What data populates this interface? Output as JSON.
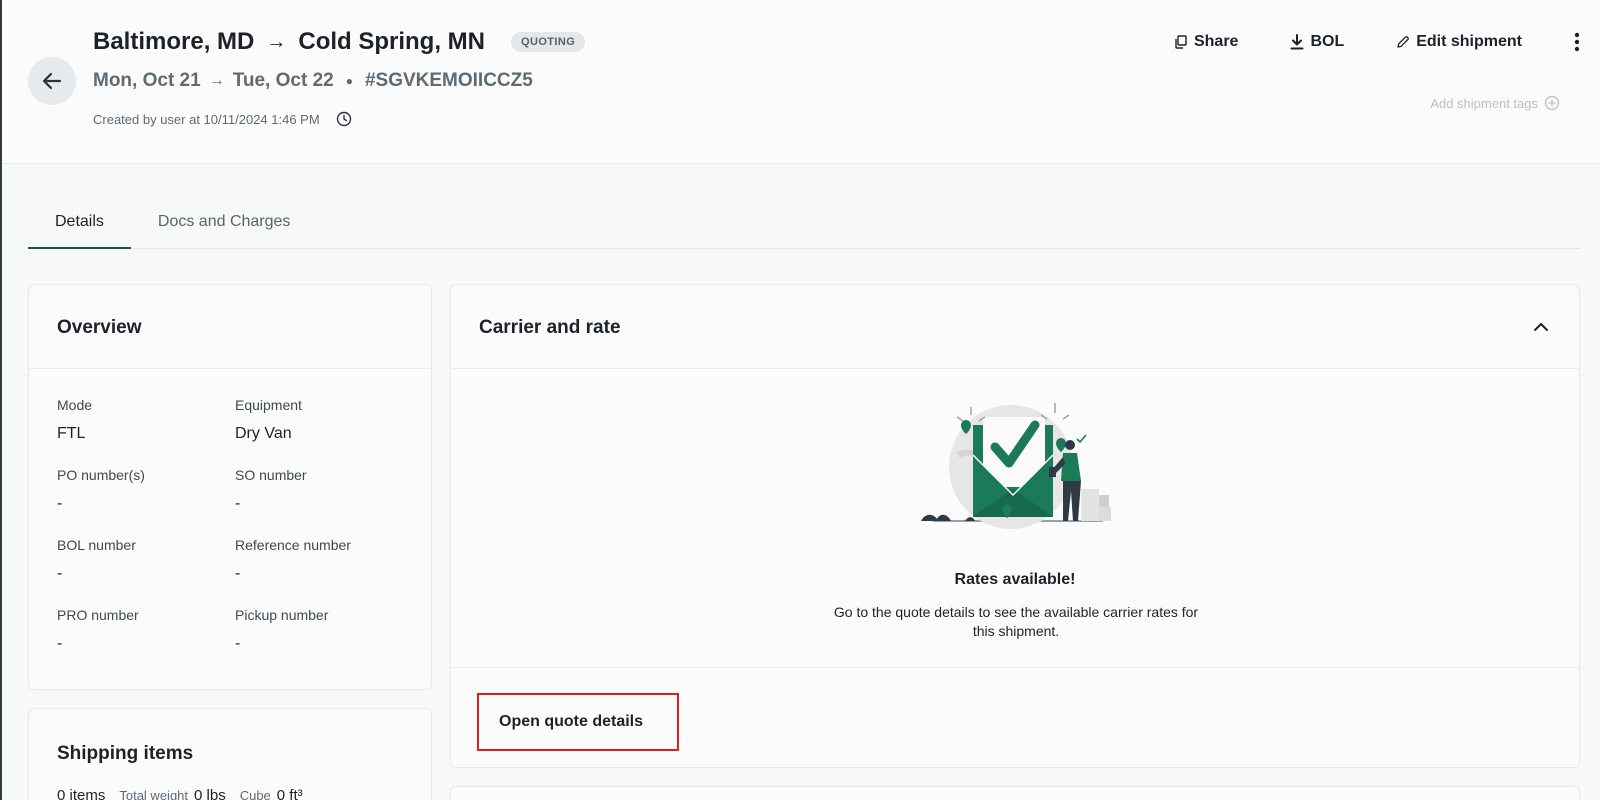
{
  "header": {
    "origin": "Baltimore, MD",
    "destination": "Cold Spring, MN",
    "route_arrow": "→",
    "status": "QUOTING",
    "pickup_date": "Mon, Oct 21",
    "delivery_date": "Tue, Oct 22",
    "date_arrow": "→",
    "separator": "●",
    "shipment_id": "#SGVKEMOIICCZ5",
    "created_text": "Created by user at 10/11/2024 1:46 PM",
    "actions": {
      "share": "Share",
      "bol": "BOL",
      "edit": "Edit shipment"
    },
    "add_tags": "Add shipment tags"
  },
  "tabs": [
    {
      "label": "Details",
      "active": true
    },
    {
      "label": "Docs and Charges",
      "active": false
    }
  ],
  "overview": {
    "title": "Overview",
    "fields": [
      {
        "label": "Mode",
        "value": "FTL"
      },
      {
        "label": "Equipment",
        "value": "Dry Van"
      },
      {
        "label": "PO number(s)",
        "value": "-"
      },
      {
        "label": "SO number",
        "value": "-"
      },
      {
        "label": "BOL number",
        "value": "-"
      },
      {
        "label": "Reference number",
        "value": "-"
      },
      {
        "label": "PRO number",
        "value": "-"
      },
      {
        "label": "Pickup number",
        "value": "-"
      }
    ]
  },
  "shipping_items": {
    "title": "Shipping items",
    "items": "0 items",
    "total_weight_label": "Total weight",
    "total_weight": "0 lbs",
    "cube_label": "Cube",
    "cube": "0 ft³"
  },
  "carrier": {
    "title": "Carrier and rate",
    "rates_title": "Rates available!",
    "rates_description": "Go to the quote details to see the available carrier rates for this shipment.",
    "open_button": "Open quote details"
  },
  "colors": {
    "brand_green": "#1b7a5a",
    "highlight_red": "#e02020",
    "badge_bg": "#e3e7ea"
  }
}
